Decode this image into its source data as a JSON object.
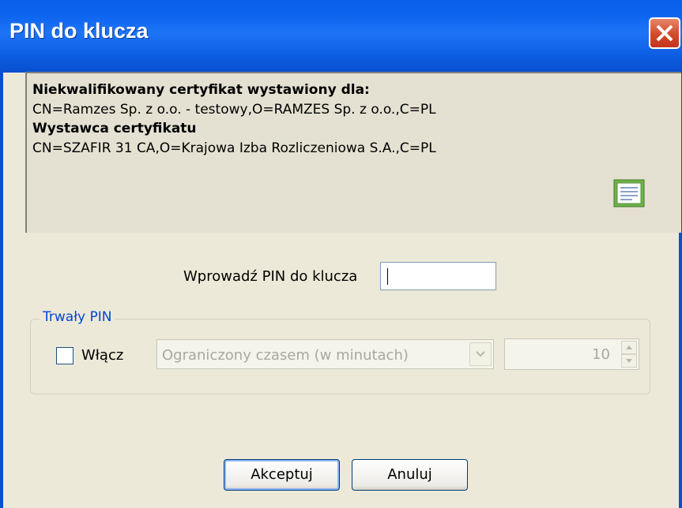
{
  "window": {
    "title": "PIN do klucza"
  },
  "certificate": {
    "subject_heading": "Niekwalifikowany certyfikat wystawiony dla:",
    "subject": "CN=Ramzes Sp. z o.o. - testowy,O=RAMZES Sp. z o.o.,C=PL",
    "issuer_heading": "Wystawca certyfikatu",
    "issuer": "CN=SZAFIR 31 CA,O=Krajowa Izba Rozliczeniowa S.A.,C=PL",
    "icon": "certificate-icon"
  },
  "pin": {
    "label": "Wprowadź PIN do klucza",
    "value": ""
  },
  "persistent": {
    "group_label": "Trwały PIN",
    "enable_label": "Włącz",
    "enabled": false,
    "mode_selected": "Ograniczony czasem (w minutach)",
    "minutes": "10"
  },
  "buttons": {
    "accept": "Akceptuj",
    "cancel": "Anuluj"
  },
  "colors": {
    "titlebar": "#0B5BE0",
    "close": "#D4492B",
    "group_label": "#0046D5",
    "background": "#ECE9D8"
  }
}
